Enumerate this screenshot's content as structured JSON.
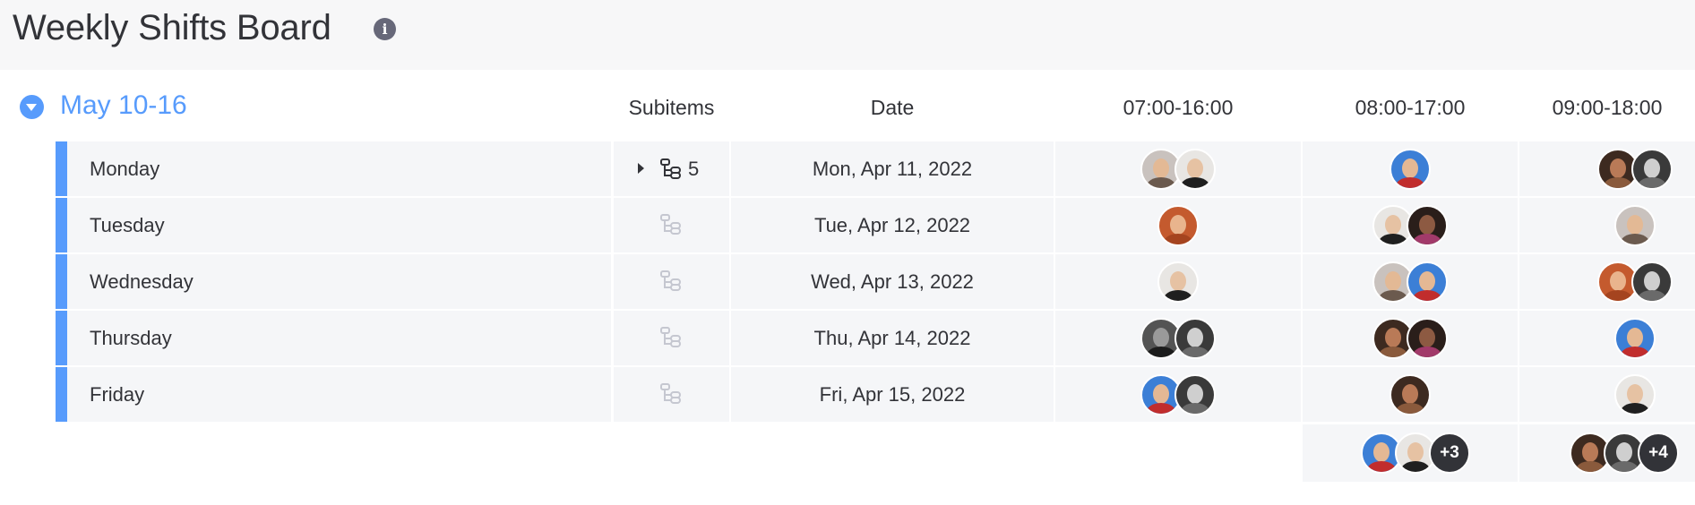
{
  "board": {
    "title": "Weekly Shifts Board",
    "info_icon": "info-icon"
  },
  "group": {
    "title": "May 10-16",
    "color": "#579bfc",
    "toggle_icon": "chevron-down-circle-icon"
  },
  "columns": {
    "subitems": "Subitems",
    "date": "Date",
    "shift1": "07:00-16:00",
    "shift2": "08:00-17:00",
    "shift3": "09:00-18:00"
  },
  "rows": [
    {
      "name": "Monday",
      "date": "Mon, Apr 11, 2022",
      "subitems_count": "5",
      "shift1": [
        "woman-light-hair",
        "man-dark-shirt"
      ],
      "shift2": [
        "superhero"
      ],
      "shift3": [
        "woman-curly",
        "woman-gray"
      ]
    },
    {
      "name": "Tuesday",
      "date": "Tue, Apr 12, 2022",
      "subitems_count": "",
      "shift1": [
        "woman-red-hair"
      ],
      "shift2": [
        "man-dark-shirt",
        "woman-dark"
      ],
      "shift3": [
        "woman-light-hair"
      ]
    },
    {
      "name": "Wednesday",
      "date": "Wed, Apr 13, 2022",
      "subitems_count": "",
      "shift1": [
        "man-dark-shirt"
      ],
      "shift2": [
        "woman-light-hair",
        "superhero"
      ],
      "shift3": [
        "woman-red-hair",
        "woman-gray"
      ]
    },
    {
      "name": "Thursday",
      "date": "Thu, Apr 14, 2022",
      "subitems_count": "",
      "shift1": [
        "woman-bw",
        "woman-gray"
      ],
      "shift2": [
        "woman-curly",
        "woman-dark"
      ],
      "shift3": [
        "superhero"
      ]
    },
    {
      "name": "Friday",
      "date": "Fri, Apr 15, 2022",
      "subitems_count": "",
      "shift1": [
        "superhero",
        "woman-gray"
      ],
      "shift2": [
        "woman-curly"
      ],
      "shift3": [
        "man-dark-shirt"
      ]
    }
  ],
  "summary": {
    "shift2": {
      "avatars": [
        "superhero",
        "man-dark-shirt"
      ],
      "more": "+3"
    },
    "shift3": {
      "avatars": [
        "woman-curly",
        "woman-gray"
      ],
      "more": "+4"
    }
  }
}
